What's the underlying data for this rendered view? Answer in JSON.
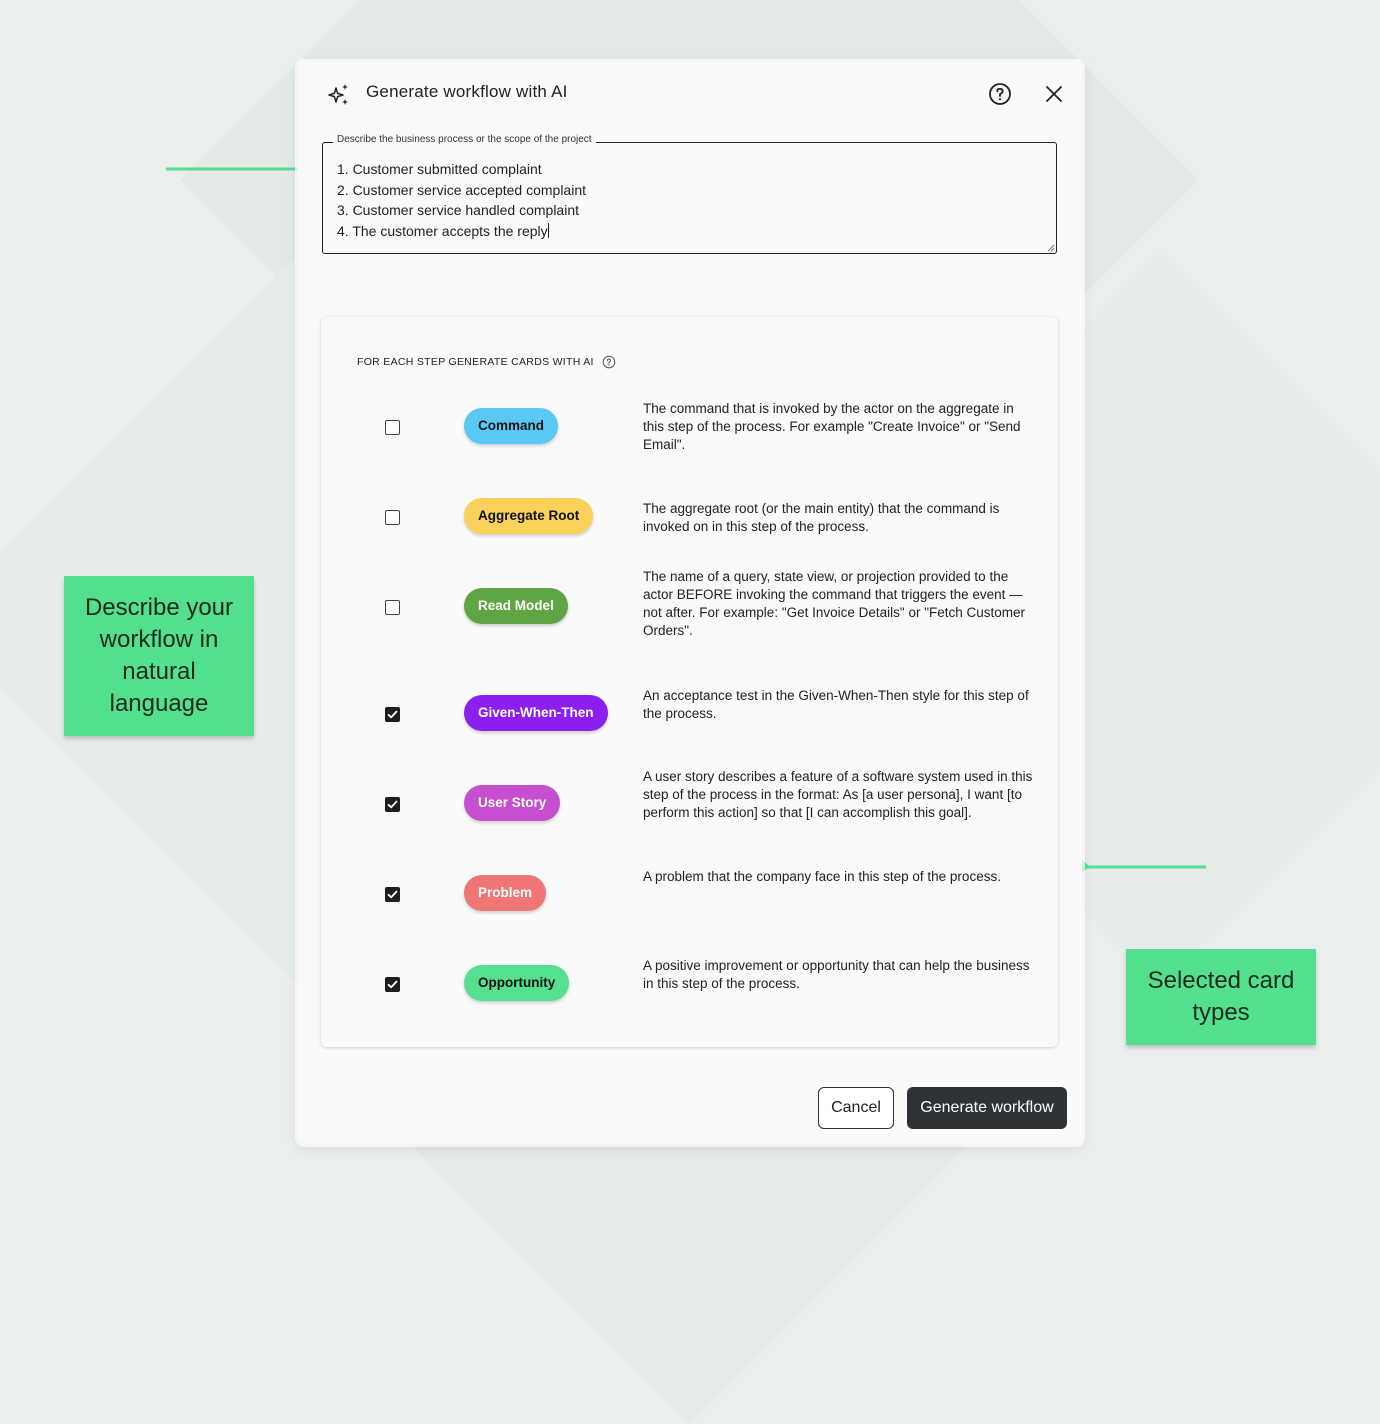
{
  "dialog": {
    "title": "Generate workflow with AI",
    "icons": {
      "title": "sparkles-icon",
      "help": "help-circle-icon",
      "close": "close-icon"
    },
    "prompt_field": {
      "label": "Describe the business process or the scope of the project",
      "lines": [
        "1. Customer submitted complaint",
        "2. Customer service accepted complaint",
        "3. Customer service handled complaint",
        "4. The customer accepts the reply"
      ]
    },
    "cards_section": {
      "title": "FOR EACH STEP GENERATE CARDS WITH AI",
      "help_icon": "help-circle-icon",
      "rows": [
        {
          "label": "Command",
          "checked": false,
          "color": "#5ac8f5",
          "text_color": "#111111",
          "description": "The command that is invoked by the actor on the aggregate in this step of the process. For example \"Create Invoice\" or \"Send Email\"."
        },
        {
          "label": "Aggregate Root",
          "checked": false,
          "color": "#fad25a",
          "text_color": "#111111",
          "description": "The aggregate root (or the main entity) that the command is invoked on in this step of the process."
        },
        {
          "label": "Read Model",
          "checked": false,
          "color": "#5fa544",
          "text_color": "#ffffff",
          "description": "The name of a query, state view, or projection provided to the actor BEFORE invoking the command that triggers the event — not after. For example: \"Get Invoice Details\" or \"Fetch Customer Orders\"."
        },
        {
          "label": "Given-When-Then",
          "checked": true,
          "color": "#8c1ff0",
          "text_color": "#ffffff",
          "description": "An acceptance test in the Given-When-Then style for this step of the process."
        },
        {
          "label": "User Story",
          "checked": true,
          "color": "#c64fcf",
          "text_color": "#ffffff",
          "description": "A user story describes a feature of a software system used in this step of the process in the format: As [a user persona], I want [to perform this action] so that [I can accomplish this goal]."
        },
        {
          "label": "Problem",
          "checked": true,
          "color": "#f07575",
          "text_color": "#ffffff",
          "description": "A problem that the company face in this step of the process."
        },
        {
          "label": "Opportunity",
          "checked": true,
          "color": "#55e090",
          "text_color": "#111111",
          "description": "A positive improvement or opportunity that can help the business in this step of the process."
        }
      ]
    },
    "buttons": {
      "cancel": "Cancel",
      "generate": "Generate workflow"
    }
  },
  "callouts": {
    "left": "Describe your workflow in natural language",
    "right": "Selected card types",
    "color": "#53e08e"
  }
}
